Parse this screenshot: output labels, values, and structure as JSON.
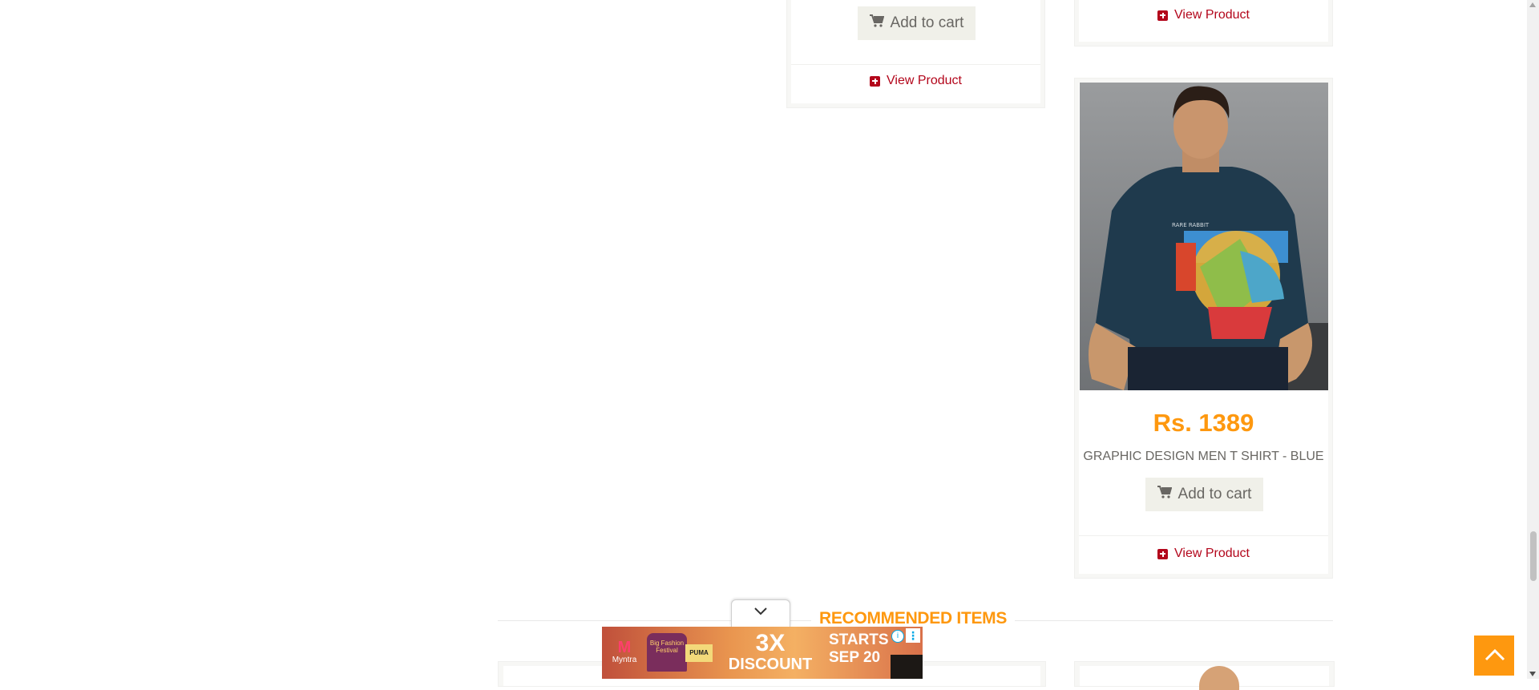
{
  "products": [
    {
      "add_label": "Add to cart",
      "view_label": "View Product"
    },
    {
      "view_label": "View Product"
    },
    {
      "price": "Rs. 1389",
      "name": "GRAPHIC DESIGN MEN T SHIRT - BLUE",
      "add_label": "Add to cart",
      "view_label": "View Product"
    }
  ],
  "section": {
    "title": "RECOMMENDED ITEMS"
  },
  "ad": {
    "brand": "Myntra",
    "fest": "Big Fashion Festival",
    "partner": "PUMA",
    "headline": "3X",
    "sub": "DISCOUNT",
    "starts": "STARTS",
    "date": "SEP 20"
  },
  "colors": {
    "accent": "#fe980f",
    "link": "#b3061b",
    "button_bg": "#f0f0e9"
  }
}
